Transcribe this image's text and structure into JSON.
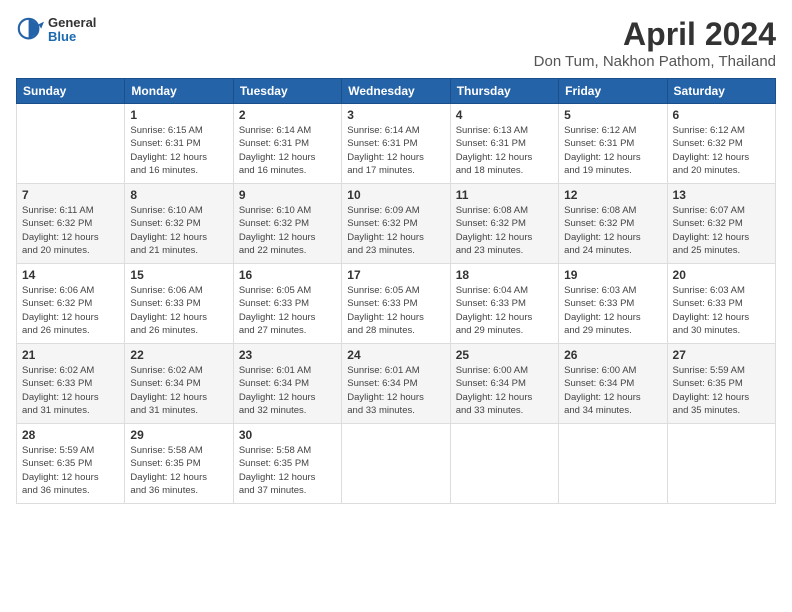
{
  "header": {
    "logo_general": "General",
    "logo_blue": "Blue",
    "month_title": "April 2024",
    "location": "Don Tum, Nakhon Pathom, Thailand"
  },
  "days_of_week": [
    "Sunday",
    "Monday",
    "Tuesday",
    "Wednesday",
    "Thursday",
    "Friday",
    "Saturday"
  ],
  "weeks": [
    [
      {
        "day": "",
        "info": ""
      },
      {
        "day": "1",
        "info": "Sunrise: 6:15 AM\nSunset: 6:31 PM\nDaylight: 12 hours\nand 16 minutes."
      },
      {
        "day": "2",
        "info": "Sunrise: 6:14 AM\nSunset: 6:31 PM\nDaylight: 12 hours\nand 16 minutes."
      },
      {
        "day": "3",
        "info": "Sunrise: 6:14 AM\nSunset: 6:31 PM\nDaylight: 12 hours\nand 17 minutes."
      },
      {
        "day": "4",
        "info": "Sunrise: 6:13 AM\nSunset: 6:31 PM\nDaylight: 12 hours\nand 18 minutes."
      },
      {
        "day": "5",
        "info": "Sunrise: 6:12 AM\nSunset: 6:31 PM\nDaylight: 12 hours\nand 19 minutes."
      },
      {
        "day": "6",
        "info": "Sunrise: 6:12 AM\nSunset: 6:32 PM\nDaylight: 12 hours\nand 20 minutes."
      }
    ],
    [
      {
        "day": "7",
        "info": "Sunrise: 6:11 AM\nSunset: 6:32 PM\nDaylight: 12 hours\nand 20 minutes."
      },
      {
        "day": "8",
        "info": "Sunrise: 6:10 AM\nSunset: 6:32 PM\nDaylight: 12 hours\nand 21 minutes."
      },
      {
        "day": "9",
        "info": "Sunrise: 6:10 AM\nSunset: 6:32 PM\nDaylight: 12 hours\nand 22 minutes."
      },
      {
        "day": "10",
        "info": "Sunrise: 6:09 AM\nSunset: 6:32 PM\nDaylight: 12 hours\nand 23 minutes."
      },
      {
        "day": "11",
        "info": "Sunrise: 6:08 AM\nSunset: 6:32 PM\nDaylight: 12 hours\nand 23 minutes."
      },
      {
        "day": "12",
        "info": "Sunrise: 6:08 AM\nSunset: 6:32 PM\nDaylight: 12 hours\nand 24 minutes."
      },
      {
        "day": "13",
        "info": "Sunrise: 6:07 AM\nSunset: 6:32 PM\nDaylight: 12 hours\nand 25 minutes."
      }
    ],
    [
      {
        "day": "14",
        "info": "Sunrise: 6:06 AM\nSunset: 6:32 PM\nDaylight: 12 hours\nand 26 minutes."
      },
      {
        "day": "15",
        "info": "Sunrise: 6:06 AM\nSunset: 6:33 PM\nDaylight: 12 hours\nand 26 minutes."
      },
      {
        "day": "16",
        "info": "Sunrise: 6:05 AM\nSunset: 6:33 PM\nDaylight: 12 hours\nand 27 minutes."
      },
      {
        "day": "17",
        "info": "Sunrise: 6:05 AM\nSunset: 6:33 PM\nDaylight: 12 hours\nand 28 minutes."
      },
      {
        "day": "18",
        "info": "Sunrise: 6:04 AM\nSunset: 6:33 PM\nDaylight: 12 hours\nand 29 minutes."
      },
      {
        "day": "19",
        "info": "Sunrise: 6:03 AM\nSunset: 6:33 PM\nDaylight: 12 hours\nand 29 minutes."
      },
      {
        "day": "20",
        "info": "Sunrise: 6:03 AM\nSunset: 6:33 PM\nDaylight: 12 hours\nand 30 minutes."
      }
    ],
    [
      {
        "day": "21",
        "info": "Sunrise: 6:02 AM\nSunset: 6:33 PM\nDaylight: 12 hours\nand 31 minutes."
      },
      {
        "day": "22",
        "info": "Sunrise: 6:02 AM\nSunset: 6:34 PM\nDaylight: 12 hours\nand 31 minutes."
      },
      {
        "day": "23",
        "info": "Sunrise: 6:01 AM\nSunset: 6:34 PM\nDaylight: 12 hours\nand 32 minutes."
      },
      {
        "day": "24",
        "info": "Sunrise: 6:01 AM\nSunset: 6:34 PM\nDaylight: 12 hours\nand 33 minutes."
      },
      {
        "day": "25",
        "info": "Sunrise: 6:00 AM\nSunset: 6:34 PM\nDaylight: 12 hours\nand 33 minutes."
      },
      {
        "day": "26",
        "info": "Sunrise: 6:00 AM\nSunset: 6:34 PM\nDaylight: 12 hours\nand 34 minutes."
      },
      {
        "day": "27",
        "info": "Sunrise: 5:59 AM\nSunset: 6:35 PM\nDaylight: 12 hours\nand 35 minutes."
      }
    ],
    [
      {
        "day": "28",
        "info": "Sunrise: 5:59 AM\nSunset: 6:35 PM\nDaylight: 12 hours\nand 36 minutes."
      },
      {
        "day": "29",
        "info": "Sunrise: 5:58 AM\nSunset: 6:35 PM\nDaylight: 12 hours\nand 36 minutes."
      },
      {
        "day": "30",
        "info": "Sunrise: 5:58 AM\nSunset: 6:35 PM\nDaylight: 12 hours\nand 37 minutes."
      },
      {
        "day": "",
        "info": ""
      },
      {
        "day": "",
        "info": ""
      },
      {
        "day": "",
        "info": ""
      },
      {
        "day": "",
        "info": ""
      }
    ]
  ]
}
